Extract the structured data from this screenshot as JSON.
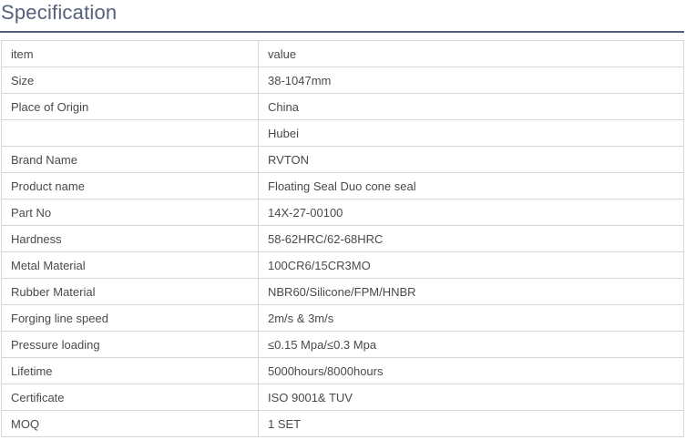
{
  "section": {
    "title": "Specification"
  },
  "table": {
    "rows": [
      {
        "item": "item",
        "value": "value"
      },
      {
        "item": "Size",
        "value": "38-1047mm"
      },
      {
        "item": "Place of Origin",
        "value": "China"
      },
      {
        "item": "",
        "value": "Hubei"
      },
      {
        "item": "Brand Name",
        "value": "RVTON"
      },
      {
        "item": "Product name",
        "value": "Floating Seal Duo cone seal"
      },
      {
        "item": "Part No",
        "value": "14X-27-00100"
      },
      {
        "item": "Hardness",
        "value": "58-62HRC/62-68HRC"
      },
      {
        "item": "Metal Material",
        "value": "100CR6/15CR3MO"
      },
      {
        "item": "Rubber Material",
        "value": "NBR60/Silicone/FPM/HNBR"
      },
      {
        "item": "Forging line speed",
        "value": "2m/s & 3m/s"
      },
      {
        "item": "Pressure loading",
        "value": "≤0.15 Mpa/≤0.3 Mpa"
      },
      {
        "item": "Lifetime",
        "value": "5000hours/8000hours"
      },
      {
        "item": "Certificate",
        "value": "ISO 9001& TUV"
      },
      {
        "item": "MOQ",
        "value": "1 SET"
      }
    ]
  }
}
